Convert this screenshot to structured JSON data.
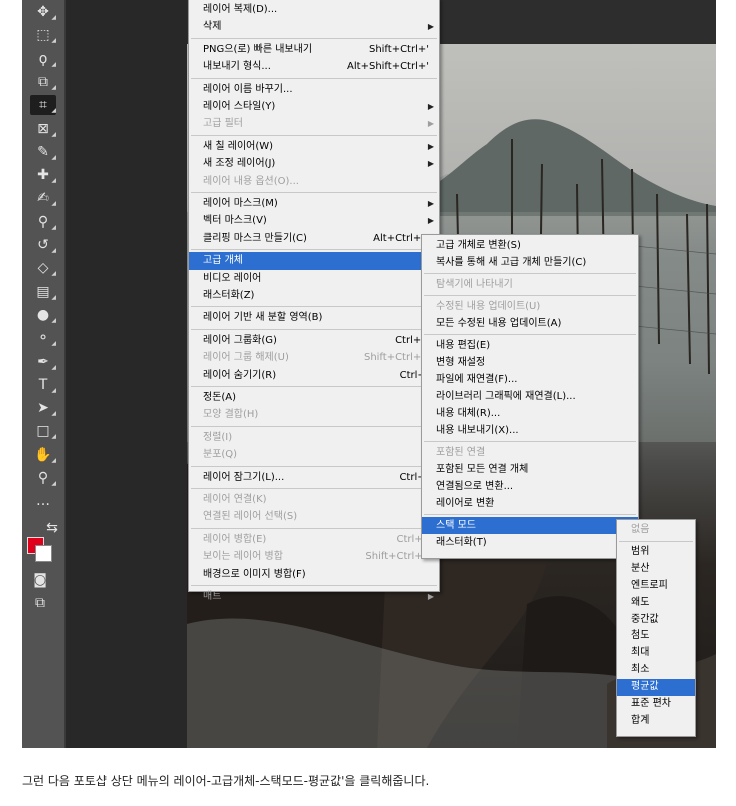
{
  "caption": "그런 다음 포토샵 상단 메뉴의 레이어-고급개체-스택모드-평균값'을 클릭해줍니다.",
  "toolbar": {
    "tools": [
      {
        "icon": "move-icon",
        "glyph": "✥"
      },
      {
        "icon": "marquee-icon",
        "glyph": "⬚"
      },
      {
        "icon": "lasso-icon",
        "glyph": "ϙ"
      },
      {
        "icon": "object-select-icon",
        "glyph": "⧉"
      },
      {
        "icon": "crop-icon",
        "glyph": "⌗"
      },
      {
        "icon": "frame-icon",
        "glyph": "⊠"
      },
      {
        "icon": "eyedropper-icon",
        "glyph": "✎"
      },
      {
        "icon": "healing-brush-icon",
        "glyph": "✚"
      },
      {
        "icon": "brush-icon",
        "glyph": "✍"
      },
      {
        "icon": "clone-stamp-icon",
        "glyph": "⚲"
      },
      {
        "icon": "history-brush-icon",
        "glyph": "↺"
      },
      {
        "icon": "eraser-icon",
        "glyph": "◇"
      },
      {
        "icon": "gradient-icon",
        "glyph": "▤"
      },
      {
        "icon": "blur-icon",
        "glyph": "●"
      },
      {
        "icon": "dodge-icon",
        "glyph": "⚬"
      },
      {
        "icon": "pen-icon",
        "glyph": "✒"
      },
      {
        "icon": "type-icon",
        "glyph": "T"
      },
      {
        "icon": "path-select-icon",
        "glyph": "➤"
      },
      {
        "icon": "rectangle-icon",
        "glyph": "□"
      },
      {
        "icon": "hand-icon",
        "glyph": "✋"
      },
      {
        "icon": "zoom-icon",
        "glyph": "⚲"
      },
      {
        "icon": "more-tools-icon",
        "glyph": "…"
      }
    ],
    "swap_glyph": "⇆",
    "quickmask_glyph": "◙",
    "screenmode_glyph": "⧉",
    "fg_color": "#e0001b",
    "bg_color": "#ffffff"
  },
  "main_menu": {
    "items": [
      {
        "label": "레이어 복제(D)..."
      },
      {
        "label": "삭제",
        "arrow": "▶"
      },
      {
        "sep": true
      },
      {
        "label": "PNG으(로) 빠른 내보내기",
        "shortcut": "Shift+Ctrl+'"
      },
      {
        "label": "내보내기 형식...",
        "shortcut": "Alt+Shift+Ctrl+'"
      },
      {
        "sep": true
      },
      {
        "label": "레이어 이름 바꾸기..."
      },
      {
        "label": "레이어 스타일(Y)",
        "arrow": "▶"
      },
      {
        "label": "고급 필터",
        "arrow": "▶",
        "disabled": true
      },
      {
        "sep": true
      },
      {
        "label": "새 칠 레이어(W)",
        "arrow": "▶"
      },
      {
        "label": "새 조정 레이어(J)",
        "arrow": "▶"
      },
      {
        "label": "레이어 내용 옵션(O)...",
        "disabled": true
      },
      {
        "sep": true
      },
      {
        "label": "레이어 마스크(M)",
        "arrow": "▶"
      },
      {
        "label": "벡터 마스크(V)",
        "arrow": "▶"
      },
      {
        "label": "클리핑 마스크 만들기(C)",
        "shortcut": "Alt+Ctrl+G"
      },
      {
        "sep": true
      },
      {
        "label": "고급 개체",
        "arrow": "▶",
        "highlight": true
      },
      {
        "label": "비디오 레이어",
        "arrow": "▶"
      },
      {
        "label": "래스터화(Z)",
        "arrow": "▶"
      },
      {
        "sep": true
      },
      {
        "label": "레이어 기반 새 분할 영역(B)"
      },
      {
        "sep": true
      },
      {
        "label": "레이어 그룹화(G)",
        "shortcut": "Ctrl+G"
      },
      {
        "label": "레이어 그룹 해제(U)",
        "shortcut": "Shift+Ctrl+G",
        "disabled": true
      },
      {
        "label": "레이어 숨기기(R)",
        "shortcut": "Ctrl+,"
      },
      {
        "sep": true
      },
      {
        "label": "정돈(A)",
        "arrow": "▶"
      },
      {
        "label": "모양 결합(H)",
        "arrow": "▶",
        "disabled": true
      },
      {
        "sep": true
      },
      {
        "label": "정렬(I)",
        "arrow": "▶",
        "disabled": true
      },
      {
        "label": "분포(Q)",
        "arrow": "▶",
        "disabled": true
      },
      {
        "sep": true
      },
      {
        "label": "레이어 잠그기(L)...",
        "shortcut": "Ctrl+/"
      },
      {
        "sep": true
      },
      {
        "label": "레이어 연결(K)",
        "disabled": true
      },
      {
        "label": "연결된 레이어 선택(S)",
        "disabled": true
      },
      {
        "sep": true
      },
      {
        "label": "레이어 병합(E)",
        "shortcut": "Ctrl+E",
        "disabled": true
      },
      {
        "label": "보이는 레이어 병합",
        "shortcut": "Shift+Ctrl+E",
        "disabled": true
      },
      {
        "label": "배경으로 이미지 병합(F)"
      },
      {
        "sep": true
      },
      {
        "label": "매트",
        "arrow": "▶",
        "disabled": true
      }
    ]
  },
  "smart_object_menu": {
    "items": [
      {
        "label": "고급 개체로 변환(S)"
      },
      {
        "label": "복사를 통해 새 고급 개체 만들기(C)"
      },
      {
        "sep": true
      },
      {
        "label": "탐색기에 나타내기",
        "disabled": true
      },
      {
        "sep": true
      },
      {
        "label": "수정된 내용 업데이트(U)",
        "disabled": true
      },
      {
        "label": "모든 수정된 내용 업데이트(A)"
      },
      {
        "sep": true
      },
      {
        "label": "내용 편집(E)"
      },
      {
        "label": "변형 재설정"
      },
      {
        "label": "파일에 재연결(F)..."
      },
      {
        "label": "라이브러리 그래픽에 재연결(L)..."
      },
      {
        "label": "내용 대체(R)..."
      },
      {
        "label": "내용 내보내기(X)..."
      },
      {
        "sep": true
      },
      {
        "label": "포함된 연결",
        "disabled": true
      },
      {
        "label": "포함된 모든 연결 개체"
      },
      {
        "label": "연결됨으로 변환..."
      },
      {
        "label": "레이어로 변환"
      },
      {
        "sep": true
      },
      {
        "label": "스택 모드",
        "arrow": "▶",
        "highlight": true
      },
      {
        "label": "래스터화(T)"
      }
    ]
  },
  "stack_mode_menu": {
    "items": [
      {
        "label": "없음",
        "disabled": true
      },
      {
        "sep": true
      },
      {
        "label": "범위"
      },
      {
        "label": "분산"
      },
      {
        "label": "엔트로피"
      },
      {
        "label": "왜도"
      },
      {
        "label": "중간값"
      },
      {
        "label": "첨도"
      },
      {
        "label": "최대"
      },
      {
        "label": "최소"
      },
      {
        "label": "평균값",
        "highlight": true
      },
      {
        "label": "표준 편차"
      },
      {
        "label": "합계"
      }
    ]
  }
}
